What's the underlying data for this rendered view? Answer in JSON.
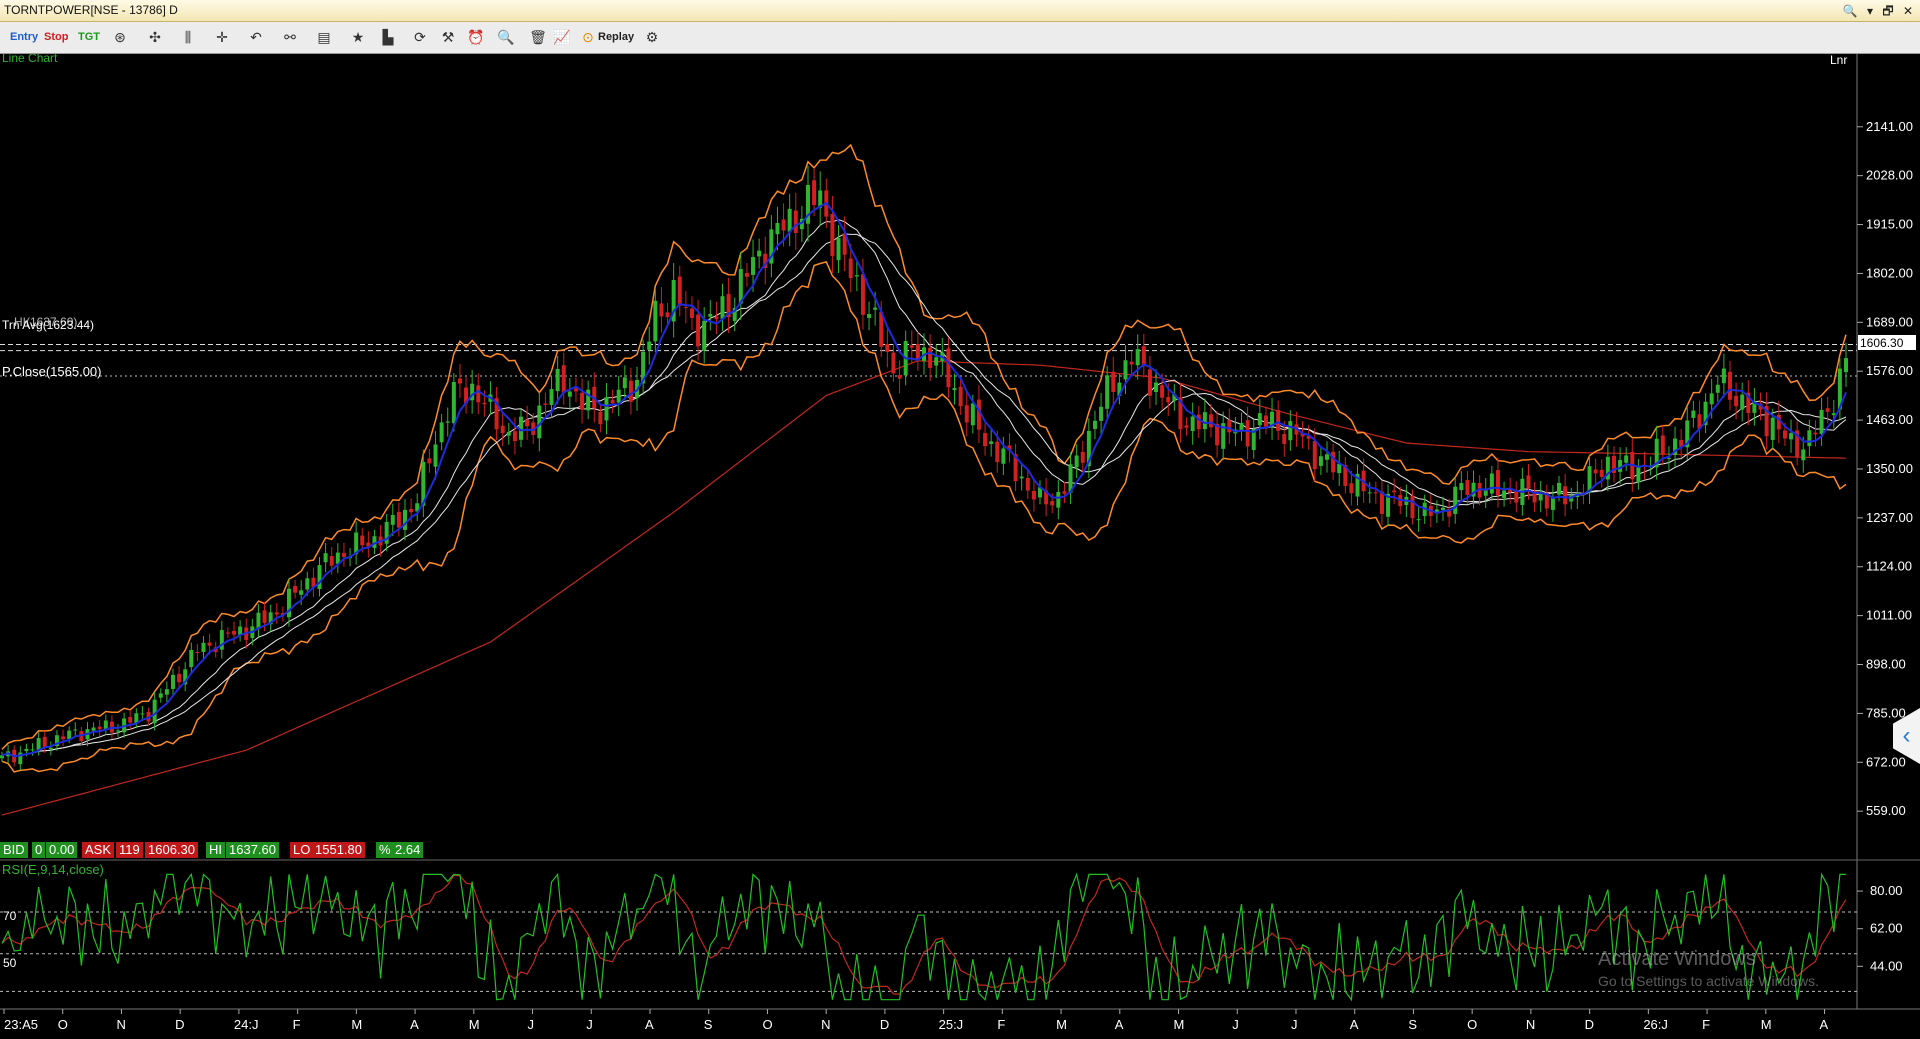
{
  "window": {
    "title": "TORNTPOWER[NSE - 13786] D",
    "controls": "🔍 ▾ 🗗 ✕"
  },
  "toolbar": {
    "entry_label": "Entry",
    "stop_label": "Stop",
    "tgt_label": "TGT",
    "replay_label": "Replay",
    "icons": [
      "compass-icon",
      "cursor-icon",
      "bar-style-icon",
      "crosshair-icon",
      "undo-icon",
      "link-icon",
      "book-icon",
      "star-icon",
      "chart-type-icon",
      "refresh-icon",
      "tools-icon",
      "alert-icon",
      "zoom-icon",
      "delete-icon",
      "indicator-icon",
      "replay-icon",
      "settings-icon"
    ]
  },
  "colors": {
    "background": "#000000",
    "candle_up": "#2fb52f",
    "candle_down": "#d12020",
    "bollinger": "#ff8a2a",
    "ma_fast": "#1c2bdc",
    "ma_slow": "#e8e8e8",
    "ema200": "#c0281e",
    "rsi": "#22c022",
    "rsi_signal": "#c0281e"
  },
  "main_panel": {
    "top_left_label": "Line Chart",
    "scale_mode": "Lnr",
    "reference_lines": [
      {
        "label": "Trn Avg(1623.44)",
        "price": 1623.44
      },
      {
        "label": "HI(1637.60)",
        "price": 1637.6
      },
      {
        "label": "P.Close(1565.00)",
        "price": 1565.0
      }
    ],
    "last_price": "1606.30"
  },
  "quote_bar": {
    "bid_label": "BID",
    "bid_qty": "0",
    "bid_price": "0.00",
    "ask_label": "ASK",
    "ask_qty": "119",
    "ask_price": "1606.30",
    "hi_label": "HI",
    "hi_value": "1637.60",
    "lo_label": "LO",
    "lo_value": "1551.80",
    "pct_label": "%",
    "pct_value": "2.64"
  },
  "rsi_panel": {
    "label": "RSI(E,9,14,close)",
    "left_levels": [
      "70",
      "50"
    ]
  },
  "watermark": {
    "line1": "Activate Windows",
    "line2": "Go to Settings to activate Windows."
  },
  "chart_data": {
    "type": "candlestick",
    "title": "TORNTPOWER[NSE - 13786] D",
    "y_ticks": [
      2141.0,
      2028.0,
      1915.0,
      1802.0,
      1689.0,
      1576.0,
      1463.0,
      1350.0,
      1237.0,
      1124.0,
      1011.0,
      898.0,
      785.0,
      672.0,
      559.0
    ],
    "ylim": [
      460,
      2300
    ],
    "x_ticks": [
      "23:A5",
      "O",
      "N",
      "D",
      "24:J",
      "F",
      "M",
      "A",
      "M",
      "J",
      "J",
      "A",
      "S",
      "O",
      "N",
      "D",
      "25:J",
      "F",
      "M",
      "A",
      "M",
      "J",
      "J",
      "A",
      "S",
      "O",
      "N",
      "D",
      "26:J",
      "F",
      "M",
      "A"
    ],
    "close_path": [
      [
        0,
        680
      ],
      [
        4,
        700
      ],
      [
        8,
        720
      ],
      [
        12,
        740
      ],
      [
        16,
        750
      ],
      [
        20,
        760
      ],
      [
        24,
        790
      ],
      [
        28,
        860
      ],
      [
        32,
        930
      ],
      [
        36,
        960
      ],
      [
        40,
        980
      ],
      [
        44,
        1010
      ],
      [
        48,
        1060
      ],
      [
        52,
        1120
      ],
      [
        56,
        1160
      ],
      [
        60,
        1180
      ],
      [
        64,
        1220
      ],
      [
        68,
        1280
      ],
      [
        71,
        1420
      ],
      [
        74,
        1520
      ],
      [
        77,
        1540
      ],
      [
        80,
        1480
      ],
      [
        83,
        1430
      ],
      [
        86,
        1440
      ],
      [
        89,
        1510
      ],
      [
        92,
        1560
      ],
      [
        95,
        1500
      ],
      [
        98,
        1490
      ],
      [
        101,
        1520
      ],
      [
        104,
        1560
      ],
      [
        107,
        1700
      ],
      [
        110,
        1760
      ],
      [
        113,
        1680
      ],
      [
        116,
        1690
      ],
      [
        119,
        1730
      ],
      [
        122,
        1800
      ],
      [
        125,
        1870
      ],
      [
        128,
        1910
      ],
      [
        131,
        1950
      ],
      [
        134,
        1980
      ],
      [
        137,
        1850
      ],
      [
        140,
        1780
      ],
      [
        143,
        1680
      ],
      [
        146,
        1580
      ],
      [
        149,
        1620
      ],
      [
        152,
        1620
      ],
      [
        155,
        1560
      ],
      [
        158,
        1480
      ],
      [
        161,
        1420
      ],
      [
        164,
        1380
      ],
      [
        167,
        1330
      ],
      [
        170,
        1270
      ],
      [
        173,
        1290
      ],
      [
        176,
        1360
      ],
      [
        179,
        1470
      ],
      [
        182,
        1550
      ],
      [
        185,
        1610
      ],
      [
        188,
        1560
      ],
      [
        191,
        1500
      ],
      [
        194,
        1460
      ],
      [
        197,
        1450
      ],
      [
        200,
        1440
      ],
      [
        203,
        1430
      ],
      [
        206,
        1460
      ],
      [
        209,
        1450
      ],
      [
        212,
        1430
      ],
      [
        215,
        1390
      ],
      [
        218,
        1350
      ],
      [
        221,
        1320
      ],
      [
        224,
        1290
      ],
      [
        227,
        1280
      ],
      [
        230,
        1270
      ],
      [
        233,
        1240
      ],
      [
        236,
        1260
      ],
      [
        239,
        1300
      ],
      [
        242,
        1310
      ],
      [
        245,
        1300
      ],
      [
        248,
        1300
      ],
      [
        251,
        1290
      ],
      [
        254,
        1280
      ],
      [
        257,
        1290
      ],
      [
        260,
        1320
      ],
      [
        263,
        1370
      ],
      [
        266,
        1350
      ],
      [
        269,
        1360
      ],
      [
        272,
        1390
      ],
      [
        275,
        1420
      ],
      [
        278,
        1480
      ],
      [
        281,
        1550
      ],
      [
        284,
        1520
      ],
      [
        287,
        1480
      ],
      [
        290,
        1460
      ],
      [
        293,
        1400
      ],
      [
        296,
        1420
      ],
      [
        299,
        1480
      ],
      [
        302,
        1606.3
      ]
    ],
    "ema200_anchor": [
      [
        0,
        550
      ],
      [
        40,
        700
      ],
      [
        80,
        950
      ],
      [
        110,
        1250
      ],
      [
        135,
        1520
      ],
      [
        150,
        1600
      ],
      [
        170,
        1590
      ],
      [
        190,
        1560
      ],
      [
        210,
        1480
      ],
      [
        230,
        1410
      ],
      [
        250,
        1390
      ],
      [
        270,
        1385
      ],
      [
        302,
        1375
      ]
    ],
    "rsi_ylim": [
      25,
      92
    ],
    "rsi_ticks": [
      80.0,
      62.0,
      44.0
    ],
    "rsi_levels": [
      70,
      50,
      32
    ]
  }
}
